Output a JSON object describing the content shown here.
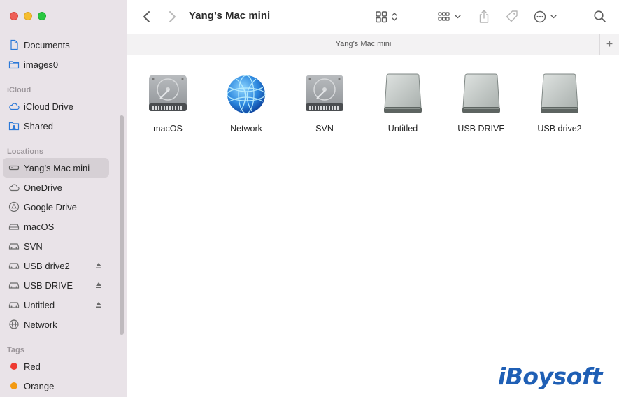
{
  "window": {
    "title": "Yang’s Mac mini",
    "tab_title": "Yang’s Mac mini",
    "tab_add": "+"
  },
  "sidebar": {
    "favorites": [
      {
        "label": "Documents",
        "icon": "document-icon"
      },
      {
        "label": "images0",
        "icon": "folder-icon"
      }
    ],
    "icloud_heading": "iCloud",
    "icloud": [
      {
        "label": "iCloud Drive",
        "icon": "cloud-icon"
      },
      {
        "label": "Shared",
        "icon": "shared-folder-icon"
      }
    ],
    "locations_heading": "Locations",
    "locations": [
      {
        "label": "Yang’s Mac mini",
        "icon": "computer-icon",
        "selected": true
      },
      {
        "label": "OneDrive",
        "icon": "cloud-icon"
      },
      {
        "label": "Google Drive",
        "icon": "google-drive-icon"
      },
      {
        "label": "macOS",
        "icon": "internal-disk-icon"
      },
      {
        "label": "SVN",
        "icon": "external-disk-icon"
      },
      {
        "label": "USB drive2",
        "icon": "external-disk-icon",
        "eject": true
      },
      {
        "label": "USB DRIVE",
        "icon": "external-disk-icon",
        "eject": true
      },
      {
        "label": "Untitled",
        "icon": "external-disk-icon",
        "eject": true
      },
      {
        "label": "Network",
        "icon": "globe-icon"
      }
    ],
    "tags_heading": "Tags",
    "tags": [
      {
        "label": "Red",
        "color": "#ee3b32"
      },
      {
        "label": "Orange",
        "color": "#f39a12"
      }
    ]
  },
  "toolbar": {
    "buttons": [
      "back-icon",
      "forward-icon",
      "icon-view-icon",
      "group-icon",
      "share-icon",
      "tag-icon",
      "more-icon",
      "search-icon"
    ]
  },
  "content": {
    "items": [
      {
        "label": "macOS",
        "icon": "internal-hard-drive"
      },
      {
        "label": "Network",
        "icon": "network-globe"
      },
      {
        "label": "SVN",
        "icon": "internal-hard-drive"
      },
      {
        "label": "Untitled",
        "icon": "external-drive"
      },
      {
        "label": "USB DRIVE",
        "icon": "external-drive"
      },
      {
        "label": "USB drive2",
        "icon": "external-drive"
      }
    ]
  },
  "watermark": "iBoysoft",
  "colors": {
    "sidebar_bg": "#e9e3e8",
    "selected_bg": "#d6d0d5",
    "accent": "#2a78d8",
    "watermark": "#1f5fb5"
  }
}
